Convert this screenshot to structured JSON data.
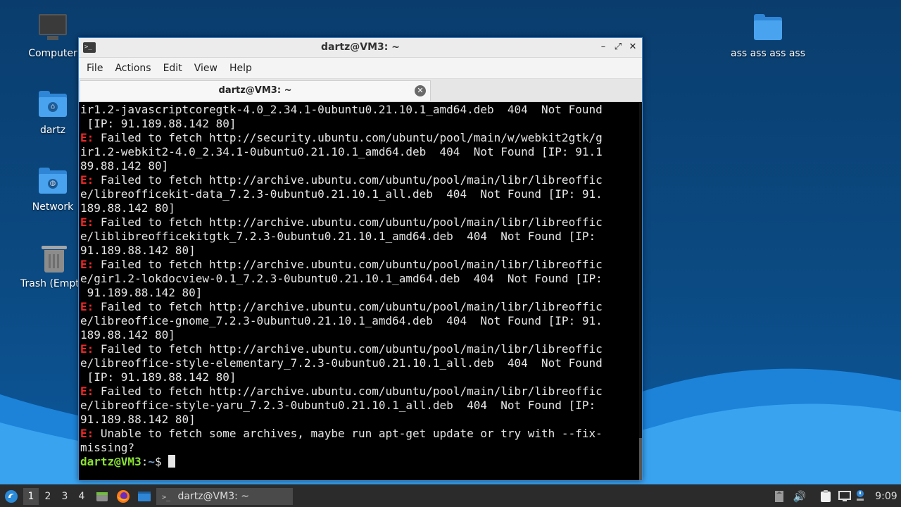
{
  "desktop": {
    "icons": [
      {
        "label": "Computer",
        "icon": "computer-icon"
      },
      {
        "label": "dartz",
        "icon": "home-folder-icon"
      },
      {
        "label": "Network",
        "icon": "network-folder-icon"
      },
      {
        "label": "Trash (Empt",
        "icon": "trash-icon"
      },
      {
        "label": "ass ass ass ass",
        "icon": "folder-icon"
      }
    ]
  },
  "window": {
    "title": "dartz@VM3: ~",
    "menu": [
      "File",
      "Actions",
      "Edit",
      "View",
      "Help"
    ],
    "tab_label": "dartz@VM3: ~",
    "controls": {
      "minimize": "–",
      "maximize": "⤢",
      "close": "✕"
    }
  },
  "terminal": {
    "lines": [
      {
        "prefix": "",
        "text": "ir1.2-javascriptcoregtk-4.0_2.34.1-0ubuntu0.21.10.1_amd64.deb  404  Not Found"
      },
      {
        "prefix": "",
        "text": " [IP: 91.189.88.142 80]"
      },
      {
        "prefix": "E:",
        "text": " Failed to fetch http://security.ubuntu.com/ubuntu/pool/main/w/webkit2gtk/g"
      },
      {
        "prefix": "",
        "text": "ir1.2-webkit2-4.0_2.34.1-0ubuntu0.21.10.1_amd64.deb  404  Not Found [IP: 91.1"
      },
      {
        "prefix": "",
        "text": "89.88.142 80]"
      },
      {
        "prefix": "E:",
        "text": " Failed to fetch http://archive.ubuntu.com/ubuntu/pool/main/libr/libreoffic"
      },
      {
        "prefix": "",
        "text": "e/libreofficekit-data_7.2.3-0ubuntu0.21.10.1_all.deb  404  Not Found [IP: 91."
      },
      {
        "prefix": "",
        "text": "189.88.142 80]"
      },
      {
        "prefix": "E:",
        "text": " Failed to fetch http://archive.ubuntu.com/ubuntu/pool/main/libr/libreoffic"
      },
      {
        "prefix": "",
        "text": "e/liblibreofficekitgtk_7.2.3-0ubuntu0.21.10.1_amd64.deb  404  Not Found [IP:"
      },
      {
        "prefix": "",
        "text": "91.189.88.142 80]"
      },
      {
        "prefix": "E:",
        "text": " Failed to fetch http://archive.ubuntu.com/ubuntu/pool/main/libr/libreoffic"
      },
      {
        "prefix": "",
        "text": "e/gir1.2-lokdocview-0.1_7.2.3-0ubuntu0.21.10.1_amd64.deb  404  Not Found [IP:"
      },
      {
        "prefix": "",
        "text": " 91.189.88.142 80]"
      },
      {
        "prefix": "E:",
        "text": " Failed to fetch http://archive.ubuntu.com/ubuntu/pool/main/libr/libreoffic"
      },
      {
        "prefix": "",
        "text": "e/libreoffice-gnome_7.2.3-0ubuntu0.21.10.1_amd64.deb  404  Not Found [IP: 91."
      },
      {
        "prefix": "",
        "text": "189.88.142 80]"
      },
      {
        "prefix": "E:",
        "text": " Failed to fetch http://archive.ubuntu.com/ubuntu/pool/main/libr/libreoffic"
      },
      {
        "prefix": "",
        "text": "e/libreoffice-style-elementary_7.2.3-0ubuntu0.21.10.1_all.deb  404  Not Found"
      },
      {
        "prefix": "",
        "text": " [IP: 91.189.88.142 80]"
      },
      {
        "prefix": "E:",
        "text": " Failed to fetch http://archive.ubuntu.com/ubuntu/pool/main/libr/libreoffic"
      },
      {
        "prefix": "",
        "text": "e/libreoffice-style-yaru_7.2.3-0ubuntu0.21.10.1_all.deb  404  Not Found [IP:"
      },
      {
        "prefix": "",
        "text": "91.189.88.142 80]"
      },
      {
        "prefix": "E:",
        "text": " Unable to fetch some archives, maybe run apt-get update or try with --fix-"
      },
      {
        "prefix": "",
        "text": "missing?"
      }
    ],
    "prompt": {
      "user_host": "dartz@VM3",
      "sep": ":",
      "path": "~",
      "symbol": "$ "
    }
  },
  "taskbar": {
    "workspaces": [
      "1",
      "2",
      "3",
      "4"
    ],
    "active_workspace": "1",
    "task_label": "dartz@VM3: ~",
    "clock": "9:09",
    "tray_icons": [
      "notes-icon",
      "volume-icon",
      "clipboard-icon",
      "network-tray-icon",
      "update-notifier-icon"
    ]
  }
}
